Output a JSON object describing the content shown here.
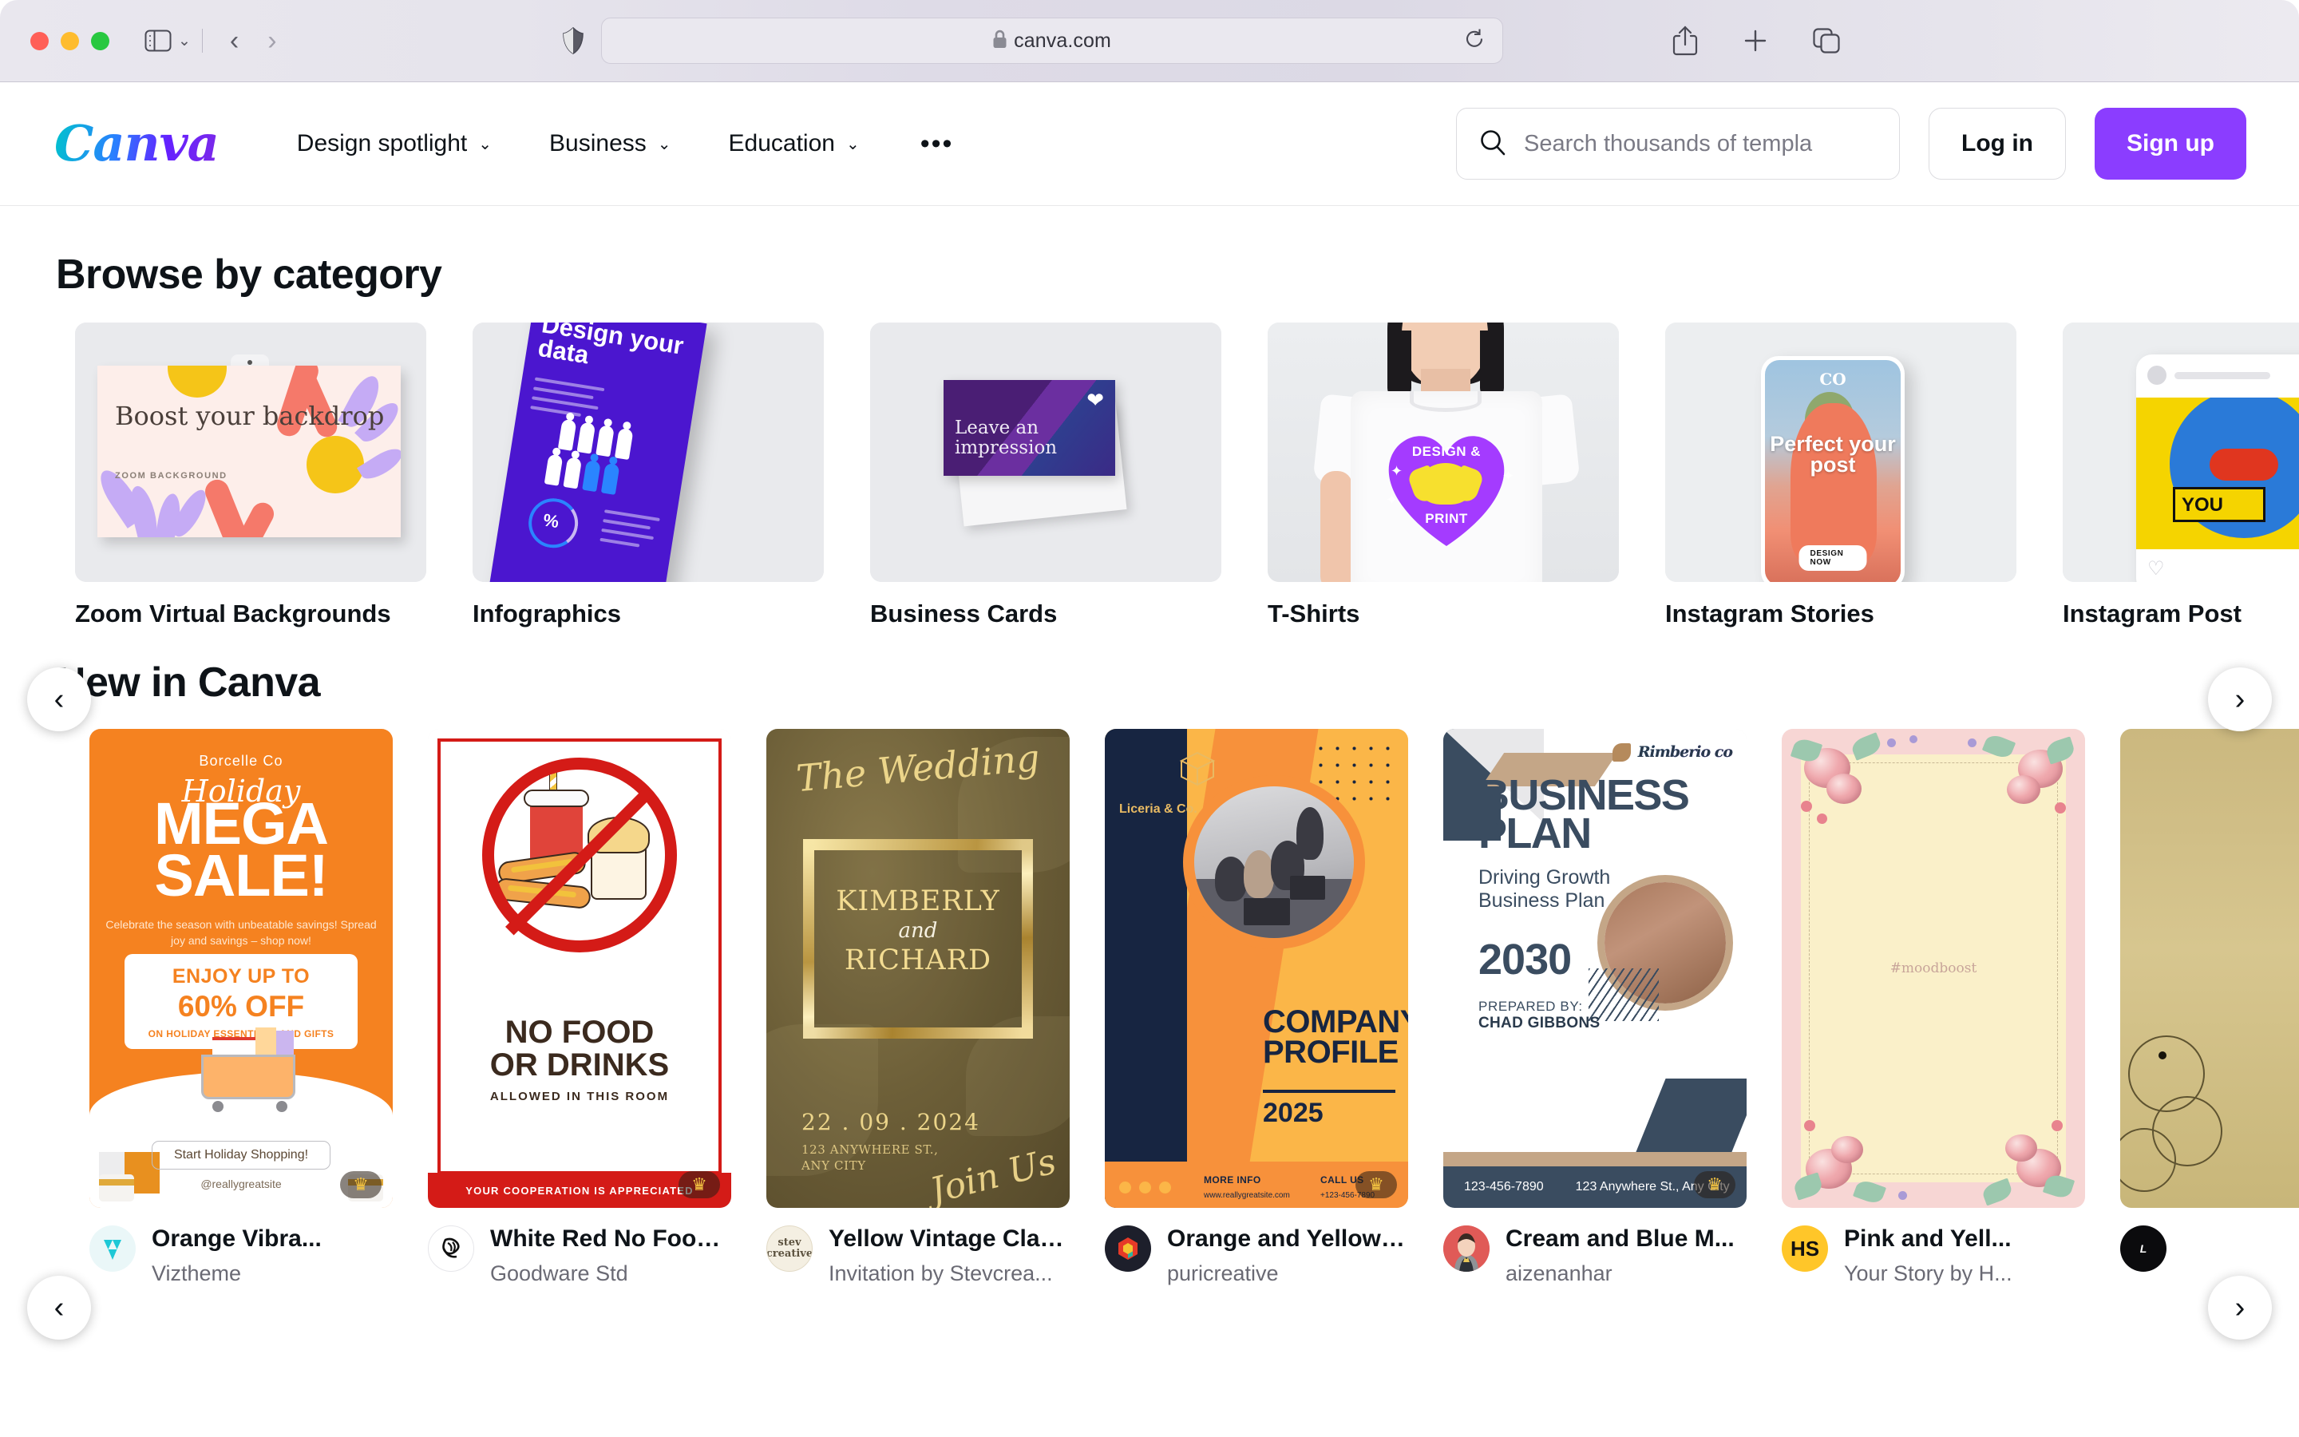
{
  "browser": {
    "url": "canva.com",
    "lock_icon": "lock-icon",
    "reload_icon": "reload-icon",
    "shield_icon": "privacy-shield-icon",
    "sidebar_icon": "sidebar-toggle-icon",
    "back_icon": "back-chevron-icon",
    "forward_icon": "forward-chevron-icon",
    "share_icon": "share-icon",
    "new_tab_icon": "plus-icon",
    "tabs_icon": "tab-overview-icon"
  },
  "header": {
    "logo": "Canva",
    "nav": [
      {
        "label": "Design spotlight",
        "caret": "⌄"
      },
      {
        "label": "Business",
        "caret": "⌄"
      },
      {
        "label": "Education",
        "caret": "⌄"
      }
    ],
    "more_label": "•••",
    "search_placeholder": "Search thousands of templa",
    "search_value": "",
    "login_label": "Log in",
    "signup_label": "Sign up",
    "signup_color": "#8b3dff"
  },
  "categories": {
    "title": "Browse by category",
    "prev_label": "‹",
    "next_label": "›",
    "items": [
      {
        "label": "Zoom Virtual Backgrounds",
        "thumb_title": "Boost your backdrop",
        "thumb_sub": "ZOOM BACKGROUND"
      },
      {
        "label": "Infographics",
        "thumb_title": "Design your data",
        "thumb_sub": "%"
      },
      {
        "label": "Business Cards",
        "thumb_title": "Leave an impression",
        "thumb_sub": ""
      },
      {
        "label": "T-Shirts",
        "thumb_title": "DESIGN &",
        "thumb_sub": "PRINT"
      },
      {
        "label": "Instagram Stories",
        "thumb_title": "Perfect your post",
        "thumb_sub": "DESIGN NOW",
        "thumb_brand": "CO"
      },
      {
        "label": "Instagram Post",
        "thumb_title": "YOU",
        "thumb_sub": ""
      }
    ]
  },
  "new_in_canva": {
    "title": "New in Canva",
    "prev_label": "‹",
    "next_label": "›",
    "items": [
      {
        "name": "Orange Vibra...",
        "author": "Viztheme",
        "avatar_type": "logo-viztheme",
        "avatar_initials": "",
        "crown": true,
        "art": {
          "brand": "Borcelle Co",
          "script": "Holiday",
          "head1": "MEGA",
          "head2": "SALE!",
          "sub": "Celebrate the season with unbeatable savings! Spread joy and savings – shop now!",
          "offer1": "ENJOY UP TO",
          "offer2": "60% OFF",
          "offer3": "ON HOLIDAY ESSENTIALS AND GIFTS",
          "cta": "Start Holiday Shopping!",
          "handle": "@reallygreatsite"
        }
      },
      {
        "name": "White Red No Food...",
        "author": "Goodware Std",
        "avatar_type": "logo-goodware",
        "avatar_initials": "",
        "crown": true,
        "art": {
          "head1": "NO FOOD",
          "head2": "OR DRINKS",
          "sub": "ALLOWED IN THIS ROOM",
          "band": "YOUR COOPERATION IS APPRECIATED"
        }
      },
      {
        "name": "Yellow Vintage Clas...",
        "author": "Invitation by Stevcrea...",
        "avatar_type": "logo-stevcreative",
        "avatar_initials": "",
        "crown": false,
        "art": {
          "script_top": "The Wedding",
          "name1": "KIMBERLY",
          "amp": "and",
          "name2": "RICHARD",
          "date": "22 . 09 . 2024",
          "addr1": "123 ANYWHERE ST.,",
          "addr2": "ANY CITY",
          "script_bottom": "Join Us"
        }
      },
      {
        "name": "Orange and Yellow ...",
        "author": "puricreative",
        "avatar_type": "logo-puricreative",
        "avatar_initials": "",
        "crown": true,
        "art": {
          "brand": "Liceria & Co.",
          "head1": "COMPANY",
          "head2": "PROFILE",
          "year": "2025",
          "f1": "MORE INFO",
          "f1s": "www.reallygreatsite.com",
          "f2": "CALL US",
          "f2s": "+123-456-7890"
        }
      },
      {
        "name": "Cream and Blue M...",
        "author": "aizenanhar",
        "avatar_type": "photo-avatar",
        "avatar_initials": "",
        "crown": true,
        "art": {
          "brand": "Rimberio co",
          "head1": "BUSINESS",
          "head2": "PLAN",
          "sub": "Driving Growth Business Plan",
          "year": "2030",
          "prepared_label": "PREPARED BY:",
          "prepared_name": "CHAD GIBBONS",
          "phone": "123-456-7890",
          "address": "123 Anywhere St., Any City"
        }
      },
      {
        "name": "Pink and Yell...",
        "author": "Your Story by H...",
        "avatar_type": "initials",
        "avatar_initials": "HS",
        "avatar_color": "#ffc629",
        "crown": false,
        "art": {
          "tag": "#moodboost"
        }
      },
      {
        "name": "",
        "author": "",
        "avatar_type": "logo-dark",
        "avatar_initials": "",
        "crown": false,
        "art": {}
      }
    ]
  }
}
